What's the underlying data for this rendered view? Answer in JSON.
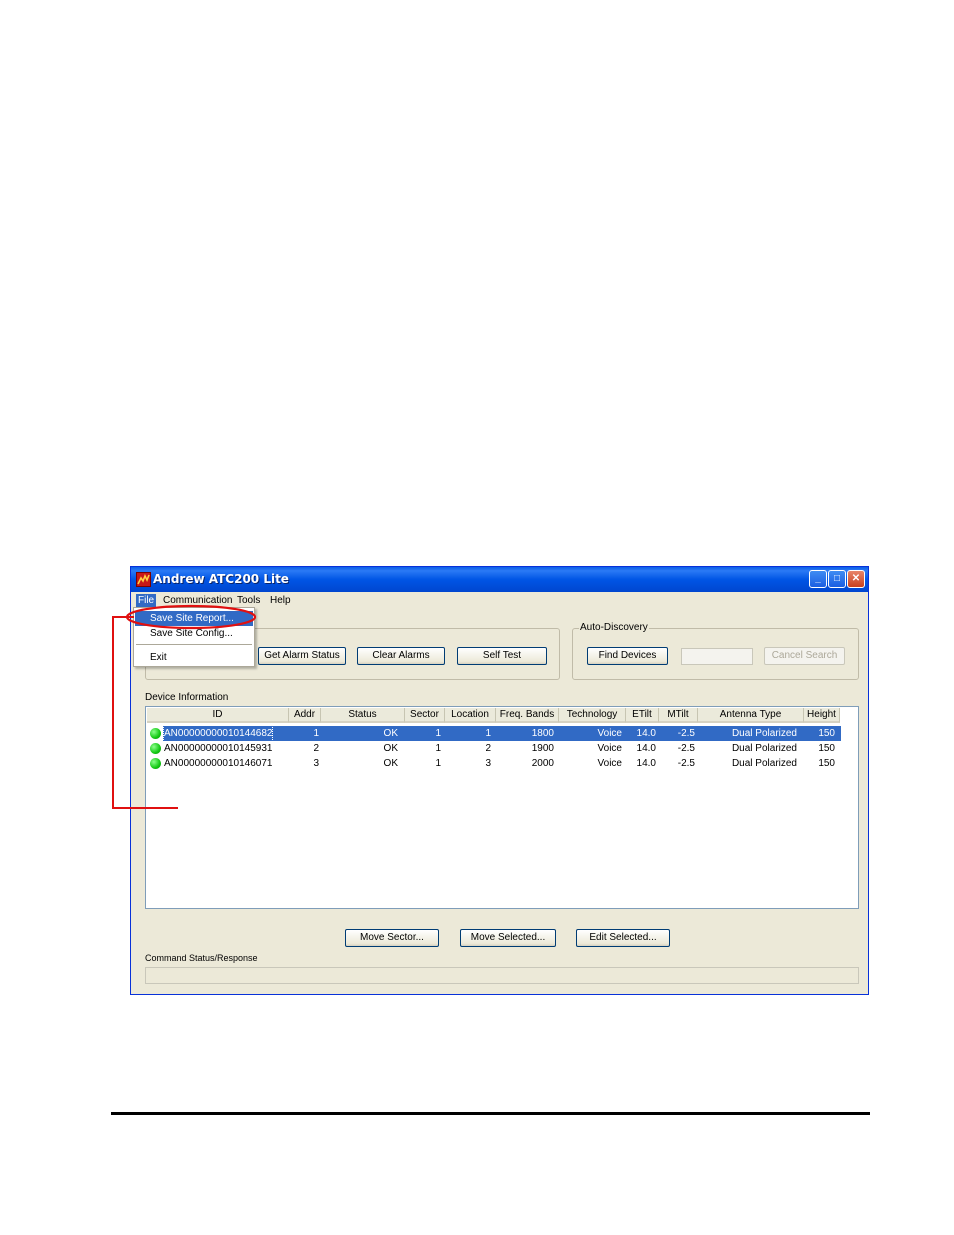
{
  "window": {
    "title": "Andrew ATC200 Lite",
    "controls": {
      "minimize": "_",
      "maximize": "□",
      "close": "✕"
    }
  },
  "menubar": {
    "items": [
      "File",
      "Communication",
      "Tools",
      "Help"
    ],
    "active_index": 0
  },
  "file_menu": {
    "items": [
      "Save Site Report...",
      "Save Site Config...",
      "Exit"
    ],
    "highlighted_index": 0
  },
  "toolbar_group": {
    "buttons": [
      "Get Alarm Status",
      "Clear Alarms",
      "Self Test"
    ]
  },
  "auto_discovery": {
    "label": "Auto-Discovery",
    "find_button": "Find Devices",
    "search_field_value": "",
    "cancel_button": "Cancel Search"
  },
  "device_information": {
    "label": "Device Information",
    "columns": [
      "ID",
      "Addr",
      "Status",
      "Sector",
      "Location",
      "Freq. Bands",
      "Technology",
      "ETilt",
      "MTilt",
      "Antenna Type",
      "Height"
    ],
    "rows": [
      [
        "AN00000000010144682",
        "1",
        "OK",
        "1",
        "1",
        "1800",
        "Voice",
        "14.0",
        "-2.5",
        "Dual Polarized",
        "150"
      ],
      [
        "AN00000000010145931",
        "2",
        "OK",
        "1",
        "2",
        "1900",
        "Voice",
        "14.0",
        "-2.5",
        "Dual Polarized",
        "150"
      ],
      [
        "AN00000000010146071",
        "3",
        "OK",
        "1",
        "3",
        "2000",
        "Voice",
        "14.0",
        "-2.5",
        "Dual Polarized",
        "150"
      ]
    ],
    "selected_row": 0,
    "status_color": "#12c812"
  },
  "bottom_buttons": [
    "Move Sector...",
    "Move Selected...",
    "Edit Selected..."
  ],
  "command_status": {
    "label": "Command Status/Response",
    "value": ""
  },
  "colors": {
    "titlebar": "#0055e5",
    "selection": "#316ac5",
    "annotation": "#e01010"
  }
}
